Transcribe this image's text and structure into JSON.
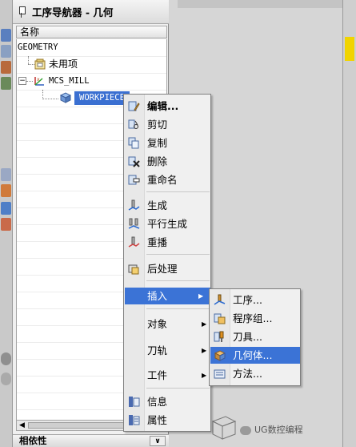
{
  "navigator": {
    "title": "工序导航器 - 几何",
    "column_header": "名称",
    "tree": [
      {
        "label": "GEOMETRY"
      },
      {
        "label": "未用项"
      },
      {
        "label": "MCS_MILL",
        "expander": "⊟"
      },
      {
        "label": "WORKPIECE",
        "selected": true
      }
    ],
    "dependency_panel": "相依性"
  },
  "context_menu": {
    "items": [
      {
        "label": "编辑...",
        "icon": "edit-icon"
      },
      {
        "label": "剪切",
        "icon": "cut-icon"
      },
      {
        "label": "复制",
        "icon": "copy-icon"
      },
      {
        "label": "删除",
        "icon": "delete-icon"
      },
      {
        "label": "重命名",
        "icon": "rename-icon"
      },
      {
        "label": "生成",
        "icon": "generate-icon"
      },
      {
        "label": "平行生成",
        "icon": "parallel-generate-icon"
      },
      {
        "label": "重播",
        "icon": "replay-icon"
      },
      {
        "label": "后处理",
        "icon": "postprocess-icon"
      },
      {
        "label": "插入",
        "submenu": true
      },
      {
        "label": "对象",
        "submenu": true
      },
      {
        "label": "刀轨",
        "submenu": true
      },
      {
        "label": "工件",
        "submenu": true
      },
      {
        "label": "信息",
        "icon": "info-icon"
      },
      {
        "label": "属性",
        "icon": "properties-icon"
      }
    ]
  },
  "insert_submenu": {
    "items": [
      {
        "label": "工序...",
        "icon": "operation-icon"
      },
      {
        "label": "程序组...",
        "icon": "program-group-icon"
      },
      {
        "label": "刀具...",
        "icon": "tool-icon"
      },
      {
        "label": "几何体...",
        "icon": "geometry-icon",
        "highlighted": true
      },
      {
        "label": "方法...",
        "icon": "method-icon"
      }
    ]
  },
  "watermark": "UG数控编程",
  "colors": {
    "highlight": "#3b73d6",
    "selection": "#3a6fd1",
    "menu_background": "#f0f0f0"
  }
}
